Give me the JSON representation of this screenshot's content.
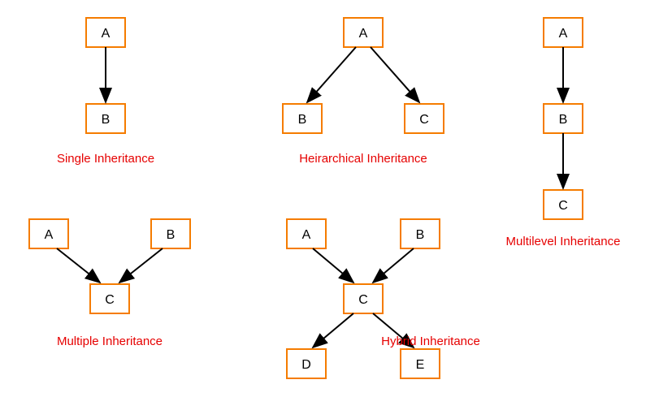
{
  "diagrams": {
    "single": {
      "title": "Single Inheritance",
      "nodes": {
        "a": "A",
        "b": "B"
      }
    },
    "hierarchical": {
      "title": "Heirarchical Inheritance",
      "nodes": {
        "a": "A",
        "b": "B",
        "c": "C"
      }
    },
    "multilevel": {
      "title": "Multilevel Inheritance",
      "nodes": {
        "a": "A",
        "b": "B",
        "c": "C"
      }
    },
    "multiple": {
      "title": "Multiple Inheritance",
      "nodes": {
        "a": "A",
        "b": "B",
        "c": "C"
      }
    },
    "hybrid": {
      "title": "Hybrid Inheritance",
      "nodes": {
        "a": "A",
        "b": "B",
        "c": "C",
        "d": "D",
        "e": "E"
      }
    }
  },
  "chart_data": [
    {
      "type": "diagram",
      "name": "Single Inheritance",
      "nodes": [
        "A",
        "B"
      ],
      "edges": [
        [
          "A",
          "B"
        ]
      ]
    },
    {
      "type": "diagram",
      "name": "Heirarchical Inheritance",
      "nodes": [
        "A",
        "B",
        "C"
      ],
      "edges": [
        [
          "A",
          "B"
        ],
        [
          "A",
          "C"
        ]
      ]
    },
    {
      "type": "diagram",
      "name": "Multilevel Inheritance",
      "nodes": [
        "A",
        "B",
        "C"
      ],
      "edges": [
        [
          "A",
          "B"
        ],
        [
          "B",
          "C"
        ]
      ]
    },
    {
      "type": "diagram",
      "name": "Multiple Inheritance",
      "nodes": [
        "A",
        "B",
        "C"
      ],
      "edges": [
        [
          "A",
          "C"
        ],
        [
          "B",
          "C"
        ]
      ]
    },
    {
      "type": "diagram",
      "name": "Hybrid Inheritance",
      "nodes": [
        "A",
        "B",
        "C",
        "D",
        "E"
      ],
      "edges": [
        [
          "A",
          "C"
        ],
        [
          "B",
          "C"
        ],
        [
          "C",
          "D"
        ],
        [
          "C",
          "E"
        ]
      ]
    }
  ]
}
